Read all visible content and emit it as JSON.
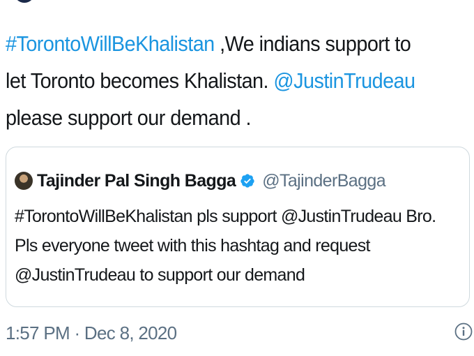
{
  "tweet": {
    "hashtag": "#TorontoWillBeKhalistan",
    "text_part1": " ,We indians support to let Toronto becomes Khalistan. ",
    "mention": "@JustinTrudeau",
    "text_part2": " please support our demand ."
  },
  "quoted_tweet": {
    "author_name": "Tajinder Pal Singh Bagga",
    "author_handle": "@TajinderBagga",
    "verified": true,
    "text": "#TorontoWillBeKhalistan pls support @JustinTrudeau Bro. Pls everyone tweet with this hashtag and request @JustinTrudeau to support our demand"
  },
  "meta": {
    "timestamp": "1:57 PM · Dec 8, 2020"
  },
  "colors": {
    "link": "#1b95e0",
    "text": "#14171a",
    "secondary": "#5b7083",
    "border": "#cfd9de"
  },
  "icons": {
    "verified": "verified-badge-icon",
    "info": "info-icon"
  }
}
